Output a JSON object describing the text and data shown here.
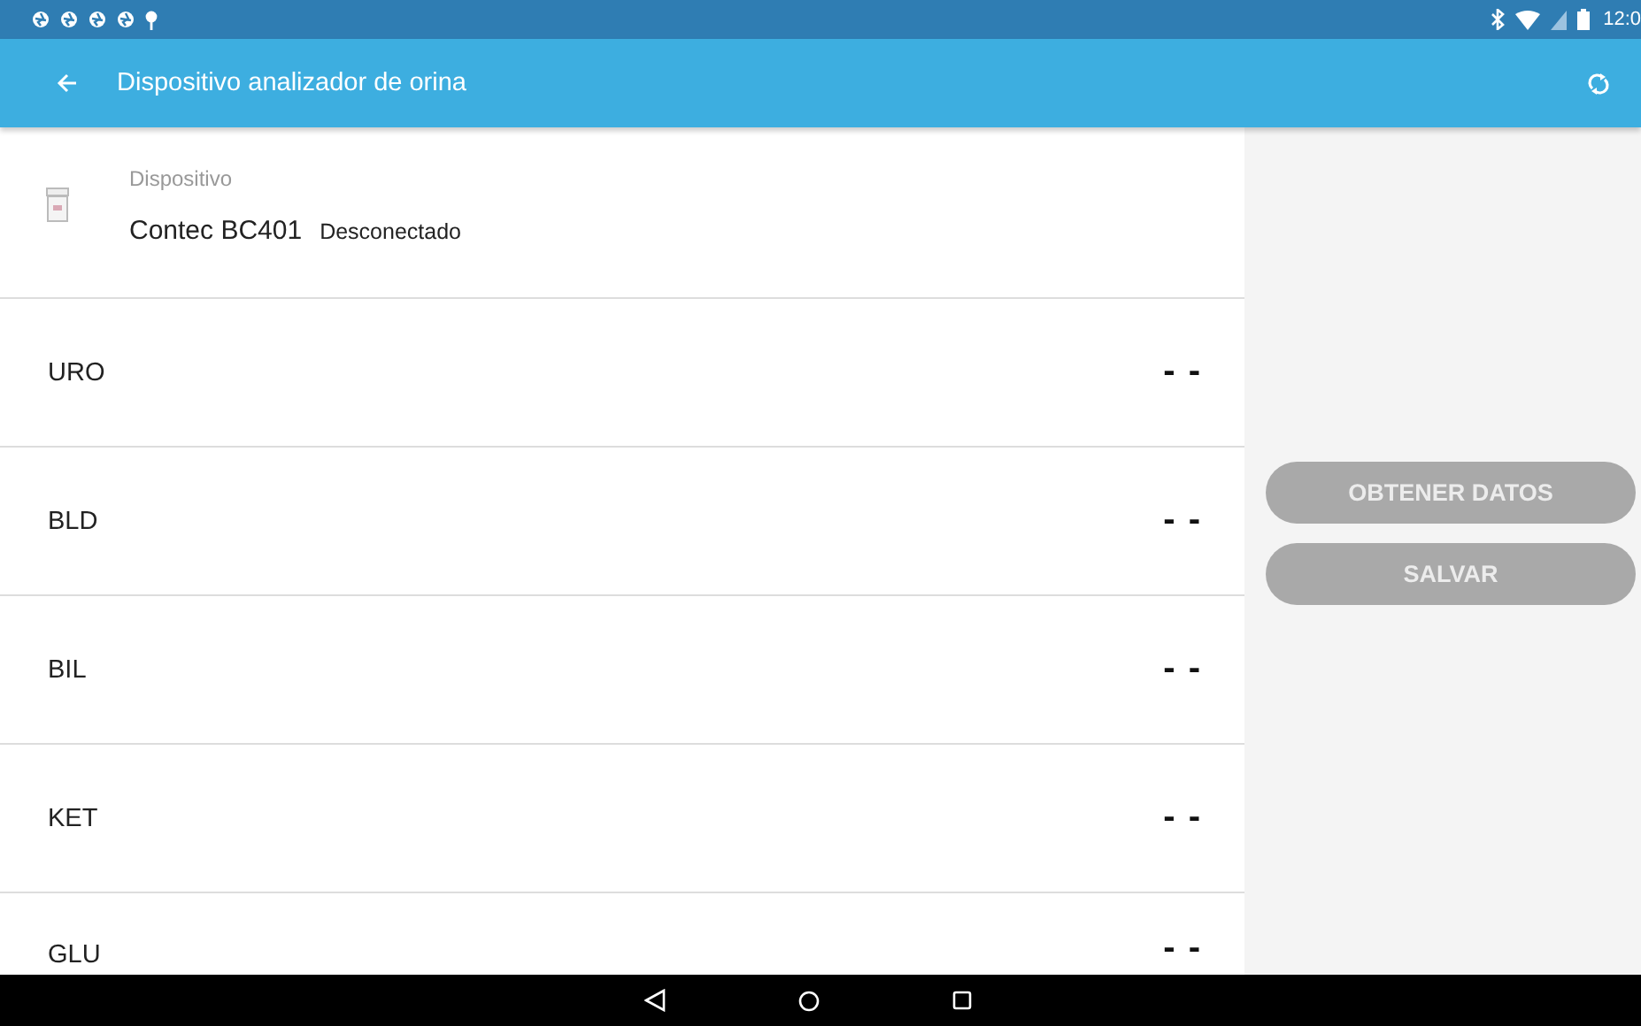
{
  "status_bar": {
    "time": "12:0"
  },
  "app_bar": {
    "title": "Dispositivo analizador de orina"
  },
  "device": {
    "label": "Dispositivo",
    "name": "Contec BC401",
    "state": "Desconectado"
  },
  "readings": [
    {
      "name": "URO",
      "value": "- -"
    },
    {
      "name": "BLD",
      "value": "- -"
    },
    {
      "name": "BIL",
      "value": "- -"
    },
    {
      "name": "KET",
      "value": "- -"
    },
    {
      "name": "GLU",
      "value": "- -"
    }
  ],
  "buttons": [
    {
      "label": "OBTENER DATOS",
      "disabled": true
    },
    {
      "label": "SALVAR",
      "disabled": true
    }
  ]
}
